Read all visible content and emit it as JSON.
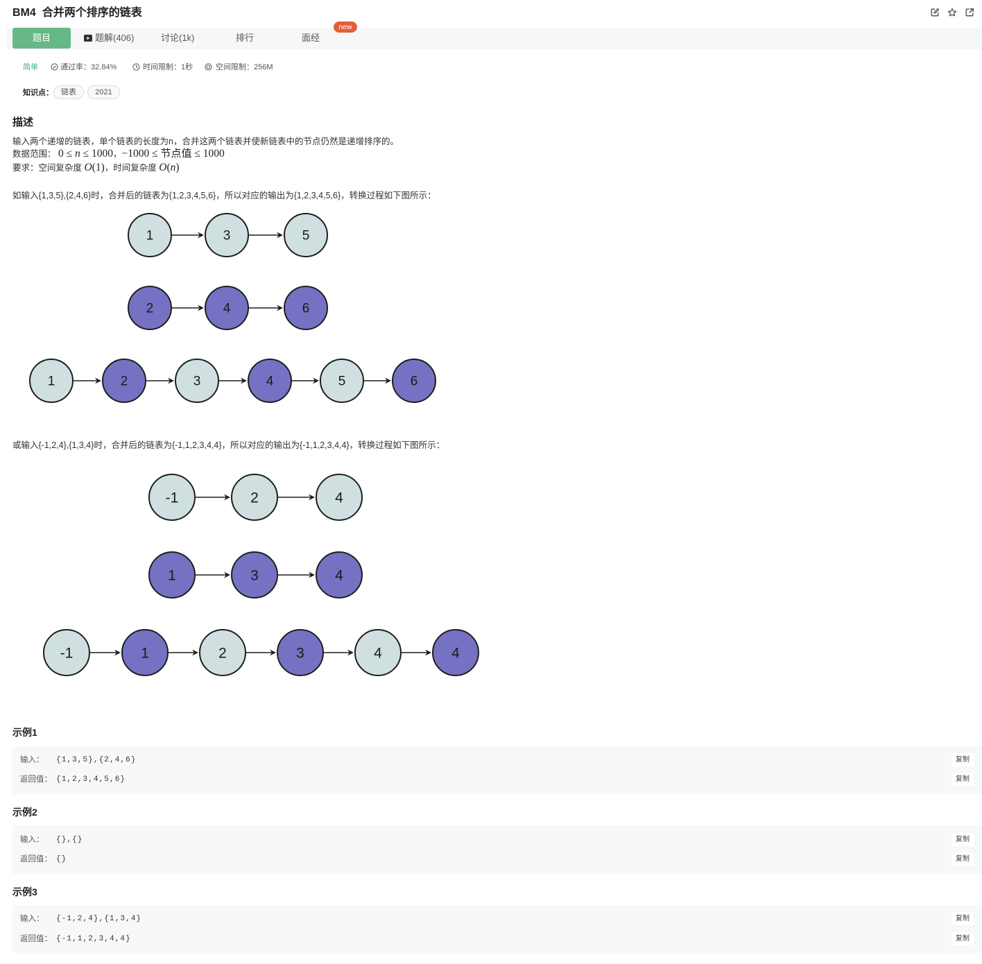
{
  "header": {
    "code": "BM4",
    "name": "合并两个排序的链表",
    "actions": [
      "edit-icon",
      "star-icon",
      "share-icon"
    ]
  },
  "tabs": [
    {
      "label": "题目",
      "active": true
    },
    {
      "label": "题解(406)",
      "icon": "video-icon"
    },
    {
      "label": "讨论(1k)"
    },
    {
      "label": "排行"
    },
    {
      "label": "面经",
      "badge": "new"
    }
  ],
  "meta": {
    "difficulty": "简单",
    "pass_rate": "通过率：32.84%",
    "time_limit": "时间限制：1秒",
    "memory_limit": "空间限制：256M",
    "icons": [
      "check-circle-icon",
      "clock-icon",
      "memory-icon"
    ]
  },
  "knowledge": {
    "label": "知识点：",
    "tags": [
      "链表",
      "2021"
    ]
  },
  "description": {
    "heading": "描述",
    "intro": "输入两个递增的链表，单个链表的长度为n，合并这两个链表并使新链表中的节点仍然是递增排序的。",
    "range": {
      "label": "数据范围： ",
      "lhs": "0 ≤ ",
      "var": "n",
      "rhs": " ≤ 1000",
      "sep": "，",
      "node_lhs": "−1000 ≤ ",
      "node_word": "节点值",
      "node_rhs": " ≤ 1000"
    },
    "requirement": {
      "label": "要求：空间复杂度 ",
      "space_o": "O",
      "space_arg": "(1)",
      "mid": "，时间复杂度 ",
      "time_o": "O",
      "time_open": "(",
      "time_var": "n",
      "time_close": ")"
    },
    "example_text_1": "如输入{1,3,5},{2,4,6}时，合并后的链表为{1,2,3,4,5,6}，所以对应的输出为{1,2,3,4,5,6}，转换过程如下图所示：",
    "example_text_2": "或输入{-1,2,4},{1,3,4}时，合并后的链表为{-1,1,2,3,4,4}，所以对应的输出为{-1,1,2,3,4,4}，转换过程如下图所示："
  },
  "colors": {
    "accent": "#66b886",
    "difficulty_easy": "#3fb67f",
    "badge": "#e0603b",
    "node_a": "#d0e0e1",
    "node_b": "#7572c3",
    "node_outline": "#1e1e1e",
    "node_label": "#1a1a1a"
  },
  "diagrams": [
    {
      "rows": [
        {
          "nodes": [
            {
              "label": "1",
              "fill": "#d0e0e1"
            },
            {
              "label": "3",
              "fill": "#d0e0e1"
            },
            {
              "label": "5",
              "fill": "#d0e0e1"
            }
          ]
        },
        {
          "nodes": [
            {
              "label": "2",
              "fill": "#7572c3"
            },
            {
              "label": "4",
              "fill": "#7572c3"
            },
            {
              "label": "6",
              "fill": "#7572c3"
            }
          ]
        },
        {
          "nodes": [
            {
              "label": "1",
              "fill": "#d0e0e1"
            },
            {
              "label": "2",
              "fill": "#7572c3"
            },
            {
              "label": "3",
              "fill": "#d0e0e1"
            },
            {
              "label": "4",
              "fill": "#7572c3"
            },
            {
              "label": "5",
              "fill": "#d0e0e1"
            },
            {
              "label": "6",
              "fill": "#7572c3"
            }
          ]
        }
      ]
    },
    {
      "rows": [
        {
          "nodes": [
            {
              "label": "-1",
              "fill": "#d0e0e1"
            },
            {
              "label": "2",
              "fill": "#d0e0e1"
            },
            {
              "label": "4",
              "fill": "#d0e0e1"
            }
          ]
        },
        {
          "nodes": [
            {
              "label": "1",
              "fill": "#7572c3"
            },
            {
              "label": "3",
              "fill": "#7572c3"
            },
            {
              "label": "4",
              "fill": "#7572c3"
            }
          ]
        },
        {
          "nodes": [
            {
              "label": "-1",
              "fill": "#d0e0e1"
            },
            {
              "label": "1",
              "fill": "#7572c3"
            },
            {
              "label": "2",
              "fill": "#d0e0e1"
            },
            {
              "label": "3",
              "fill": "#7572c3"
            },
            {
              "label": "4",
              "fill": "#d0e0e1"
            },
            {
              "label": "4",
              "fill": "#7572c3"
            }
          ]
        }
      ]
    }
  ],
  "examples": [
    {
      "title": "示例1",
      "input_label": "输入：",
      "input": "{1,3,5},{2,4,6}",
      "output_label": "返回值：",
      "output": "{1,2,3,4,5,6}",
      "copy_label": "复制"
    },
    {
      "title": "示例2",
      "input_label": "输入：",
      "input": "{},{}",
      "output_label": "返回值：",
      "output": "{}",
      "copy_label": "复制"
    },
    {
      "title": "示例3",
      "input_label": "输入：",
      "input": "{-1,2,4},{1,3,4}",
      "output_label": "返回值：",
      "output": "{-1,1,2,3,4,4}",
      "copy_label": "复制"
    }
  ]
}
